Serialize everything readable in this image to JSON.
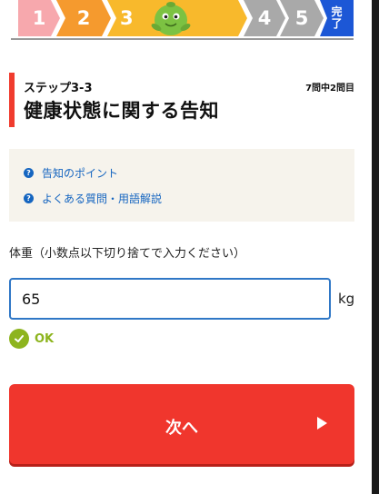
{
  "progress": {
    "steps": [
      "1",
      "2",
      "3",
      "4",
      "5"
    ],
    "final_step": [
      "完",
      "了"
    ],
    "current_step": 3,
    "colors": {
      "done_1": "#f7a8ad",
      "done_2": "#f59a2e",
      "current": "#f8b92c",
      "pending": "#a9a9a9",
      "final": "#1c57d6"
    }
  },
  "header": {
    "step_label": "ステップ3-3",
    "question_count": "7問中2問目",
    "title": "健康状態に関する告知",
    "accent_color": "#f03c2e"
  },
  "help": {
    "links": [
      "告知のポイント",
      "よくある質問・用語解説"
    ],
    "icon": "question-circle-icon",
    "link_color": "#1565c0"
  },
  "form": {
    "label": "体重（小数点以下切り捨てで入力ください）",
    "value": "65",
    "unit": "kg",
    "validation": "OK",
    "validation_color": "#8db41e"
  },
  "next_button": {
    "label": "次へ",
    "color": "#f0362d"
  }
}
